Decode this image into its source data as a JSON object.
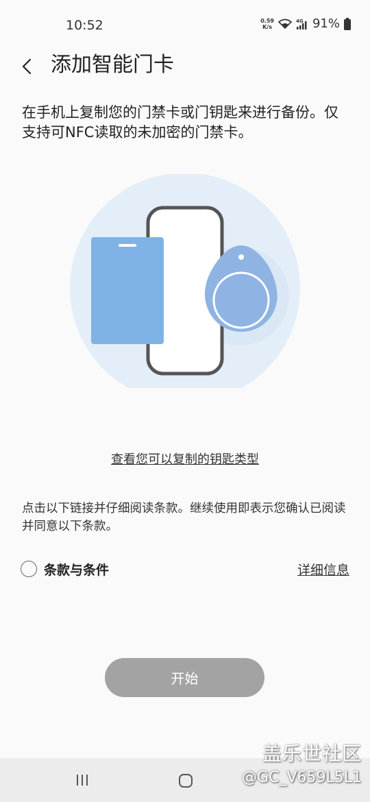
{
  "status_bar": {
    "time": "10:52",
    "net_speed_value": "0.59",
    "net_speed_unit": "K/s",
    "network_type": "4G",
    "battery": "91%"
  },
  "header": {
    "title": "添加智能门卡"
  },
  "description": "在手机上复制您的门禁卡或门钥匙来进行备份。仅支持可NFC读取的未加密的门禁卡。",
  "key_types_link": "查看您可以复制的钥匙类型",
  "notice": "点击以下链接并仔细阅读条款。继续使用即表示您确认已阅读并同意以下条款。",
  "terms": {
    "label": "条款与条件",
    "details_link": "详细信息",
    "checked": false
  },
  "start_button": "开始",
  "watermark": {
    "line1": "盖乐世社区",
    "line2": "@GC_V659L5L1"
  },
  "colors": {
    "background": "#fafafa",
    "illustration_circle": "#e3eef8",
    "card_blue": "#7fb3e8",
    "fob_blue": "#8fb4e3",
    "button_disabled": "#a3a3a3"
  }
}
